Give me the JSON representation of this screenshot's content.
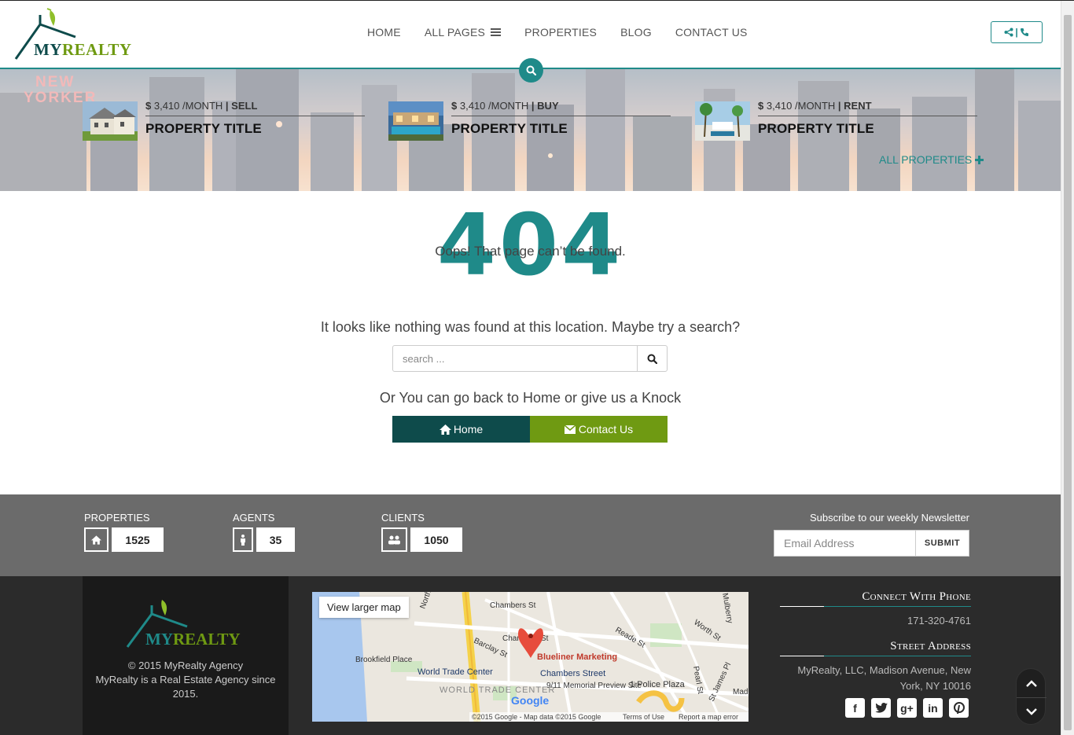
{
  "brand": {
    "my": "MY",
    "realty": "REALTY"
  },
  "nav": {
    "items": [
      {
        "label": "HOME"
      },
      {
        "label": "ALL PAGES"
      },
      {
        "label": "PROPERTIES"
      },
      {
        "label": "BLOG"
      },
      {
        "label": "CONTACT US"
      }
    ]
  },
  "header": {
    "contact_separator": "|"
  },
  "hero": {
    "properties": [
      {
        "currency": "$",
        "price": "3,410 /MONTH",
        "sep": "|",
        "type": "SELL",
        "title": "PROPERTY TITLE"
      },
      {
        "currency": "$",
        "price": "3,410 /MONTH",
        "sep": "|",
        "type": "BUY",
        "title": "PROPERTY TITLE"
      },
      {
        "currency": "$",
        "price": "3,410 /MONTH",
        "sep": "|",
        "type": "RENT",
        "title": "PROPERTY TITLE"
      }
    ],
    "all_properties_label": "ALL PROPERTIES",
    "city_sign": [
      "NEW",
      "YORKER"
    ]
  },
  "error": {
    "code": "404",
    "oops": "Oops! That page can’t be found.",
    "nothing_found": "It looks like nothing was found at this location. Maybe try a search?",
    "search_placeholder": "search ...",
    "go_back": "Or You can go back to Home or give us a Knock",
    "home_label": "Home",
    "contact_label": "Contact Us"
  },
  "stats": {
    "properties_label": "PROPERTIES",
    "properties_value": "1525",
    "agents_label": "AGENTS",
    "agents_value": "35",
    "clients_label": "CLIENTS",
    "clients_value": "1050"
  },
  "newsletter": {
    "title": "Subscribe to our weekly Newsletter",
    "email_placeholder": "Email Address",
    "submit_label": "SUBMIT"
  },
  "footer": {
    "copyright": "© 2015 MyRealty Agency",
    "description": "MyRealty is a Real Estate Agency since 2015.",
    "phone_heading": "Connect With Phone",
    "phone": "171-320-4761",
    "address_heading": "Street Address",
    "address": "MyRealty, LLC, Madison Avenue, New York, NY 10016"
  },
  "map": {
    "view_larger": "View larger map",
    "marker_label": "Blueliner Marketing",
    "streets": [
      "Chambers St",
      "Chambers St",
      "Barclay St",
      "Reade St",
      "Worth St",
      "Pearl St",
      "St James Pl",
      "Mulberry",
      "North",
      "Madison"
    ],
    "places": [
      "Brookfield Place",
      "World Trade Center",
      "Chambers Street",
      "9/11 Memorial Preview Site",
      "1 Police Plaza",
      "WORLD TRADE CENTER"
    ],
    "logo": "Google",
    "attribution": "©2015 Google - Map data ©2015 Google",
    "terms": "Terms of Use",
    "report": "Report a map error"
  },
  "colors": {
    "teal": "#1f8a89",
    "dark_teal": "#0e4b4b",
    "green": "#6f9a12",
    "stats_bg": "#6b6b6b",
    "footer_bg": "#2b2b2b"
  }
}
